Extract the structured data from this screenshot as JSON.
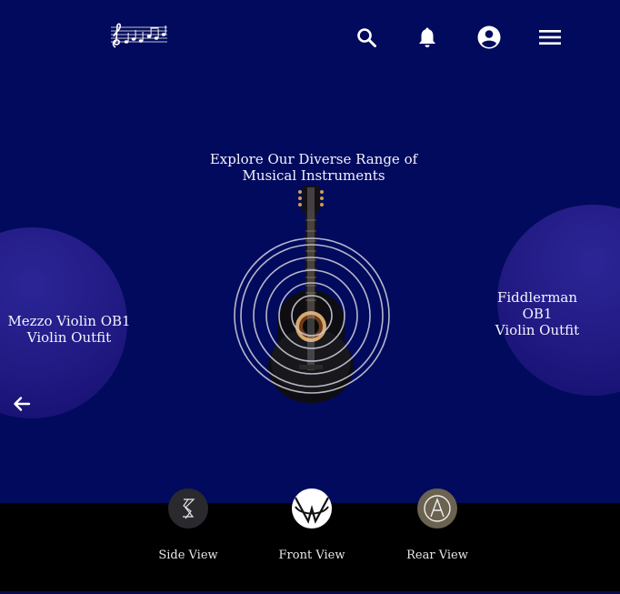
{
  "header": {
    "logo_icon": "music-notes-logo",
    "icons": [
      "search-icon",
      "bell-icon",
      "account-icon",
      "menu-icon"
    ]
  },
  "hero": {
    "title_line1": "Explore Our Diverse Range of",
    "title_line2": "Musical Instruments"
  },
  "carousel": {
    "left_card": {
      "line1": "Mezzo Violin OB1",
      "line2": "Violin Outfit"
    },
    "right_card": {
      "line1": "Fiddlerman",
      "line2": "OB1",
      "line3": "Violin Outfit"
    },
    "center_image": "acoustic-guitar",
    "prev_icon": "arrow-left-icon"
  },
  "views": [
    {
      "label": "Side View",
      "icon": "side-view-icon"
    },
    {
      "label": "Front View",
      "icon": "front-view-icon"
    },
    {
      "label": "Rear View",
      "icon": "rear-view-icon"
    }
  ],
  "colors": {
    "background": "#010a5c",
    "bubble": "#231c86",
    "footer": "#000000"
  }
}
